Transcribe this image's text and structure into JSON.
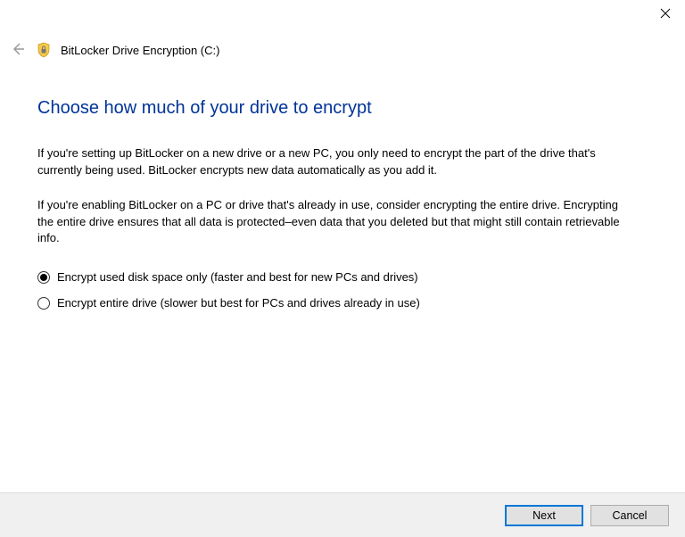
{
  "window": {
    "title": "BitLocker Drive Encryption (C:)"
  },
  "page": {
    "heading": "Choose how much of your drive to encrypt",
    "paragraph1": "If you're setting up BitLocker on a new drive or a new PC, you only need to encrypt the part of the drive that's currently being used. BitLocker encrypts new data automatically as you add it.",
    "paragraph2": "If you're enabling BitLocker on a PC or drive that's already in use, consider encrypting the entire drive. Encrypting the entire drive ensures that all data is protected–even data that you deleted but that might still contain retrievable info."
  },
  "options": {
    "opt1": "Encrypt used disk space only (faster and best for new PCs and drives)",
    "opt2": "Encrypt entire drive (slower but best for PCs and drives already in use)",
    "selected": "opt1"
  },
  "buttons": {
    "next": "Next",
    "cancel": "Cancel"
  }
}
